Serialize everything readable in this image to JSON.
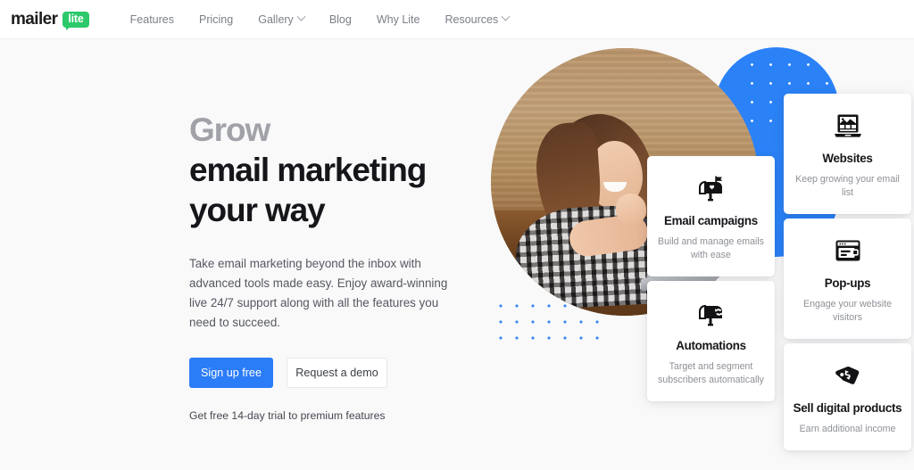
{
  "brand": {
    "logo_primary": "mailer",
    "logo_badge": "lite",
    "badge_color": "#2cc96b",
    "accent_blue": "#2b7cf7"
  },
  "nav": {
    "items": [
      {
        "label": "Features",
        "has_dropdown": false
      },
      {
        "label": "Pricing",
        "has_dropdown": false
      },
      {
        "label": "Gallery",
        "has_dropdown": true
      },
      {
        "label": "Blog",
        "has_dropdown": false
      },
      {
        "label": "Why Lite",
        "has_dropdown": false
      },
      {
        "label": "Resources",
        "has_dropdown": true
      }
    ]
  },
  "hero": {
    "headline_line1": "Grow",
    "headline_line2": "email marketing",
    "headline_line3": "your way",
    "subtext": "Take email marketing beyond the inbox with advanced tools made easy. Enjoy award-winning live 24/7 support along with all the features you need to succeed.",
    "cta_primary": "Sign up free",
    "cta_secondary": "Request a demo",
    "trial_note": "Get free 14-day trial to premium features"
  },
  "cards": [
    {
      "id": "email",
      "icon": "mailbox-heart-icon",
      "title": "Email campaigns",
      "desc": "Build and manage emails with ease"
    },
    {
      "id": "automations",
      "icon": "mailbox-sync-icon",
      "title": "Automations",
      "desc": "Target and segment subscribers automatically"
    },
    {
      "id": "websites",
      "icon": "laptop-website-icon",
      "title": "Websites",
      "desc": "Keep growing your email list"
    },
    {
      "id": "popups",
      "icon": "browser-popup-icon",
      "title": "Pop-ups",
      "desc": "Engage your website visitors"
    },
    {
      "id": "sell",
      "icon": "price-tag-dollar-icon",
      "title": "Sell digital products",
      "desc": "Earn additional income"
    }
  ]
}
